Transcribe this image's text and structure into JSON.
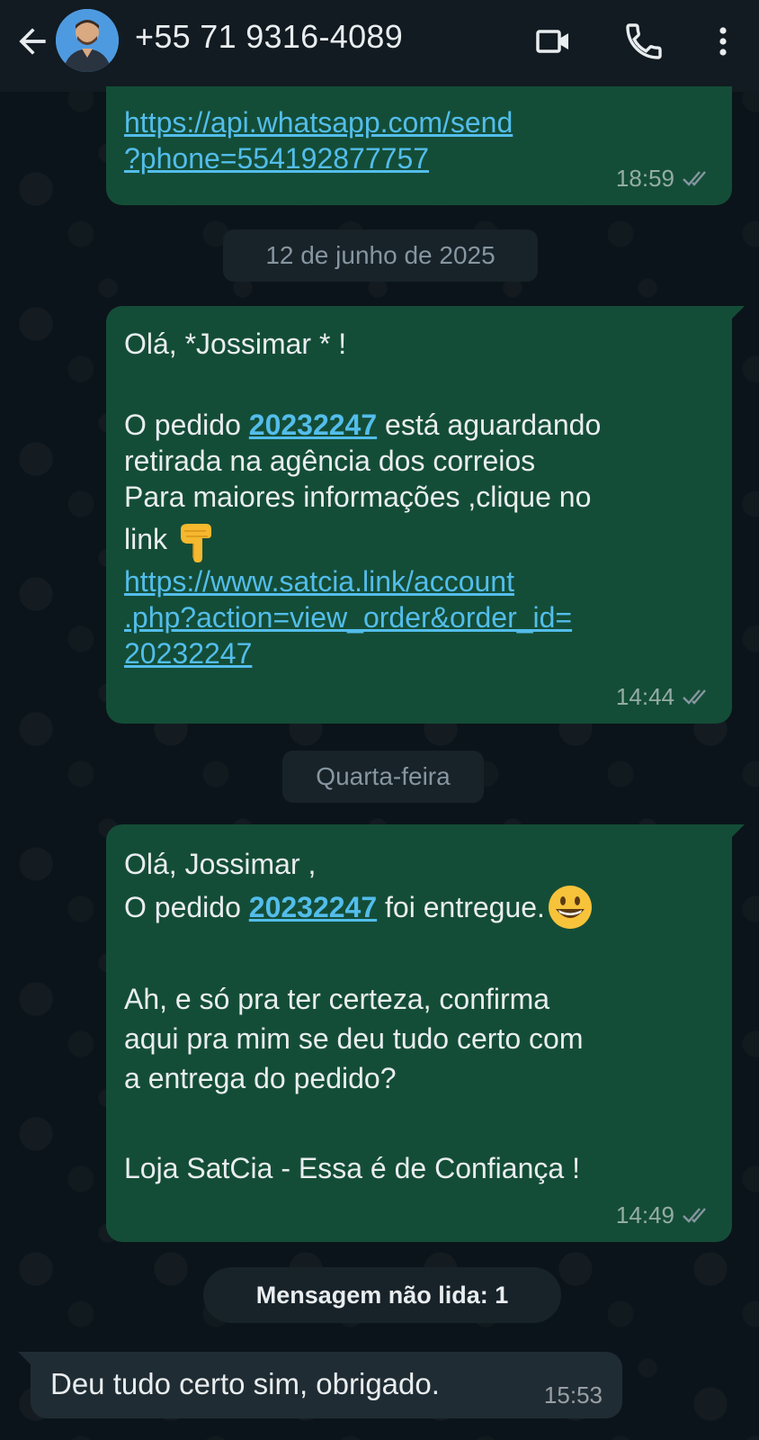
{
  "header": {
    "contact_name": "+55 71 9316-4089",
    "icons": [
      "back-arrow-icon",
      "video-call-icon",
      "phone-icon",
      "more-options-icon"
    ]
  },
  "messages": [
    {
      "direction": "outgoing",
      "lines": [
        "https://api.whatsapp.com/send",
        "?phone=554192877757"
      ],
      "time": "18:59",
      "status": "read-double-check"
    },
    {
      "divider": "12 de junho de 2025"
    },
    {
      "direction": "outgoing",
      "greeting": "Olá, *Jossimar * !",
      "order_prefix": "O pedido ",
      "order_number": "20232247",
      "order_suffix": " está aguardando",
      "line3": "retirada na agência dos correios",
      "line4": "Para maiores informações ,clique no",
      "line5": "link",
      "link_lines": [
        "https://www.satcia.link/account",
        ".php?action=view_order&order_id=",
        "20232247"
      ],
      "time": "14:44",
      "status": "read-double-check"
    },
    {
      "divider": "Quarta-feira"
    },
    {
      "direction": "outgoing",
      "greeting": "Olá, Jossimar ,",
      "order_prefix": "O pedido ",
      "order_number": "20232247",
      "order_suffix": " foi entregue.",
      "para2": [
        "Ah, e só pra ter certeza, confirma",
        "aqui pra mim se deu tudo certo com",
        "a entrega do pedido?"
      ],
      "signature": "Loja SatCia - Essa é de Confiança !",
      "time": "14:49",
      "status": "read-double-check"
    },
    {
      "unread_banner": "Mensagem não lida: 1"
    },
    {
      "direction": "incoming",
      "text": "Deu tudo certo sim, obrigado.",
      "time": "15:53"
    }
  ],
  "colors": {
    "background": "#0b141a",
    "header": "#111b21",
    "outgoing_bubble": "#144d37",
    "incoming_bubble": "#202c33",
    "link": "#53bdeb",
    "read_ticks": "#8696a0"
  }
}
